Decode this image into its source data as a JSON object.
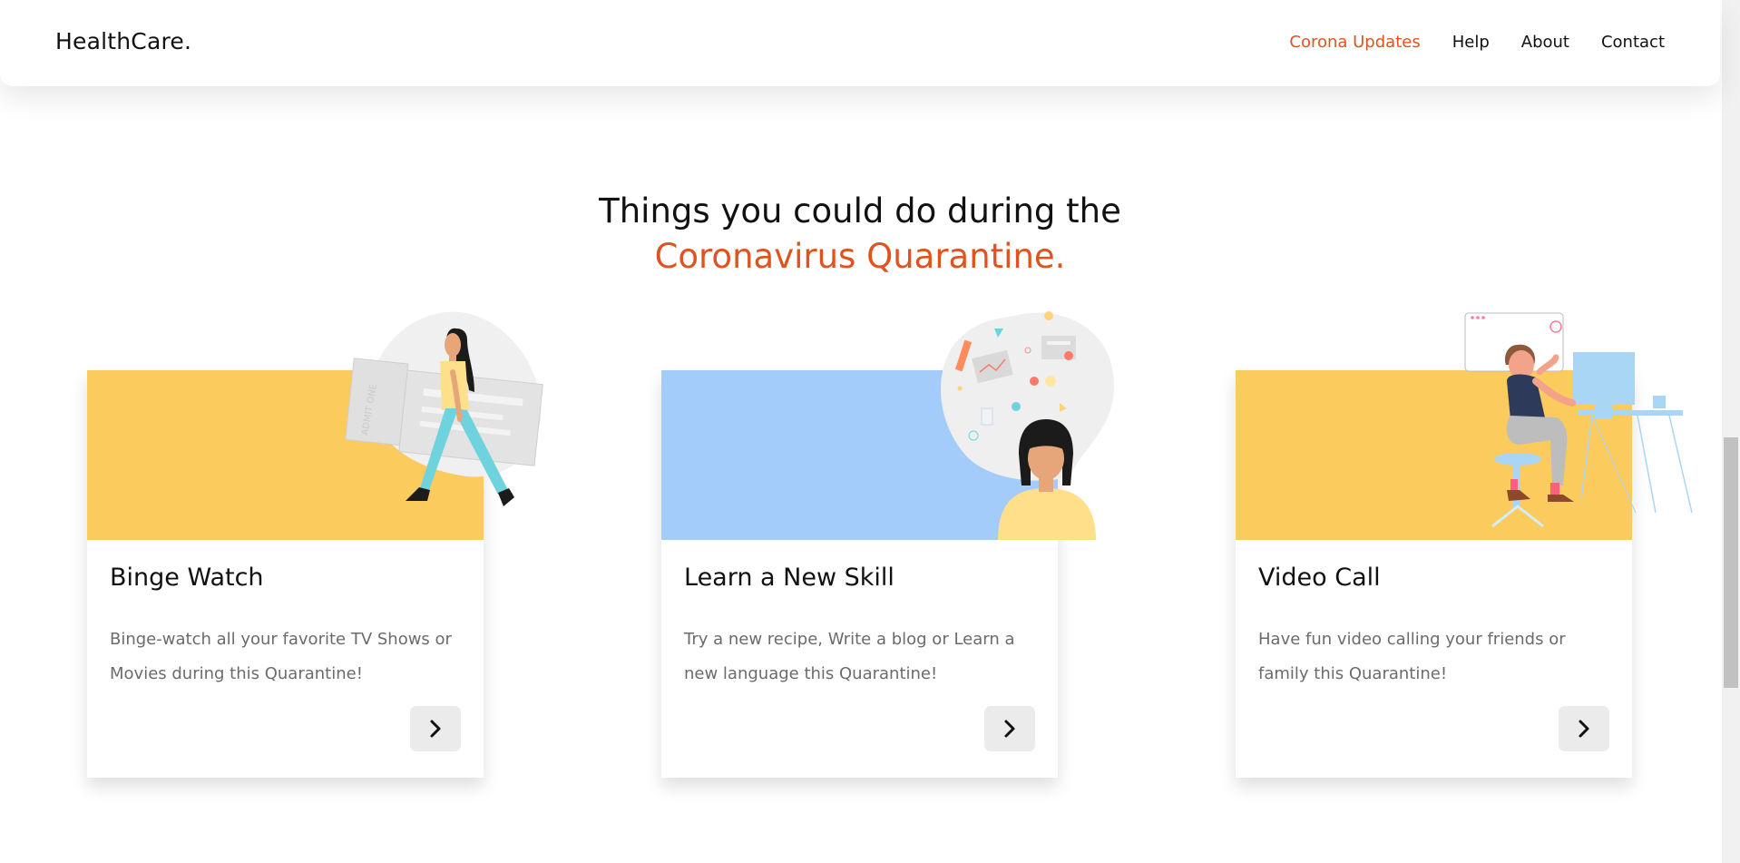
{
  "nav": {
    "brand": "HealthCare.",
    "links": [
      {
        "label": "Corona Updates",
        "active": true
      },
      {
        "label": "Help"
      },
      {
        "label": "About"
      },
      {
        "label": "Contact"
      }
    ]
  },
  "heading": {
    "line1": "Things you could do during the",
    "line2": "Coronavirus Quarantine."
  },
  "colors": {
    "accent": "#e0531f",
    "card_yellow": "#fccb5e",
    "card_blue": "#a3ccfb"
  },
  "cards": [
    {
      "title": "Binge Watch",
      "description": "Binge-watch all your favorite TV Shows or Movies during this Quarantine!",
      "icon": "chevron-right-icon"
    },
    {
      "title": "Learn a New Skill",
      "description": "Try a new recipe, Write a blog or Learn a new language this Quarantine!",
      "icon": "chevron-right-icon"
    },
    {
      "title": "Video Call",
      "description": "Have fun video calling your friends or family this Quarantine!",
      "icon": "chevron-right-icon"
    }
  ],
  "illustrations": {
    "ticket_text": "ADMIT ONE"
  }
}
